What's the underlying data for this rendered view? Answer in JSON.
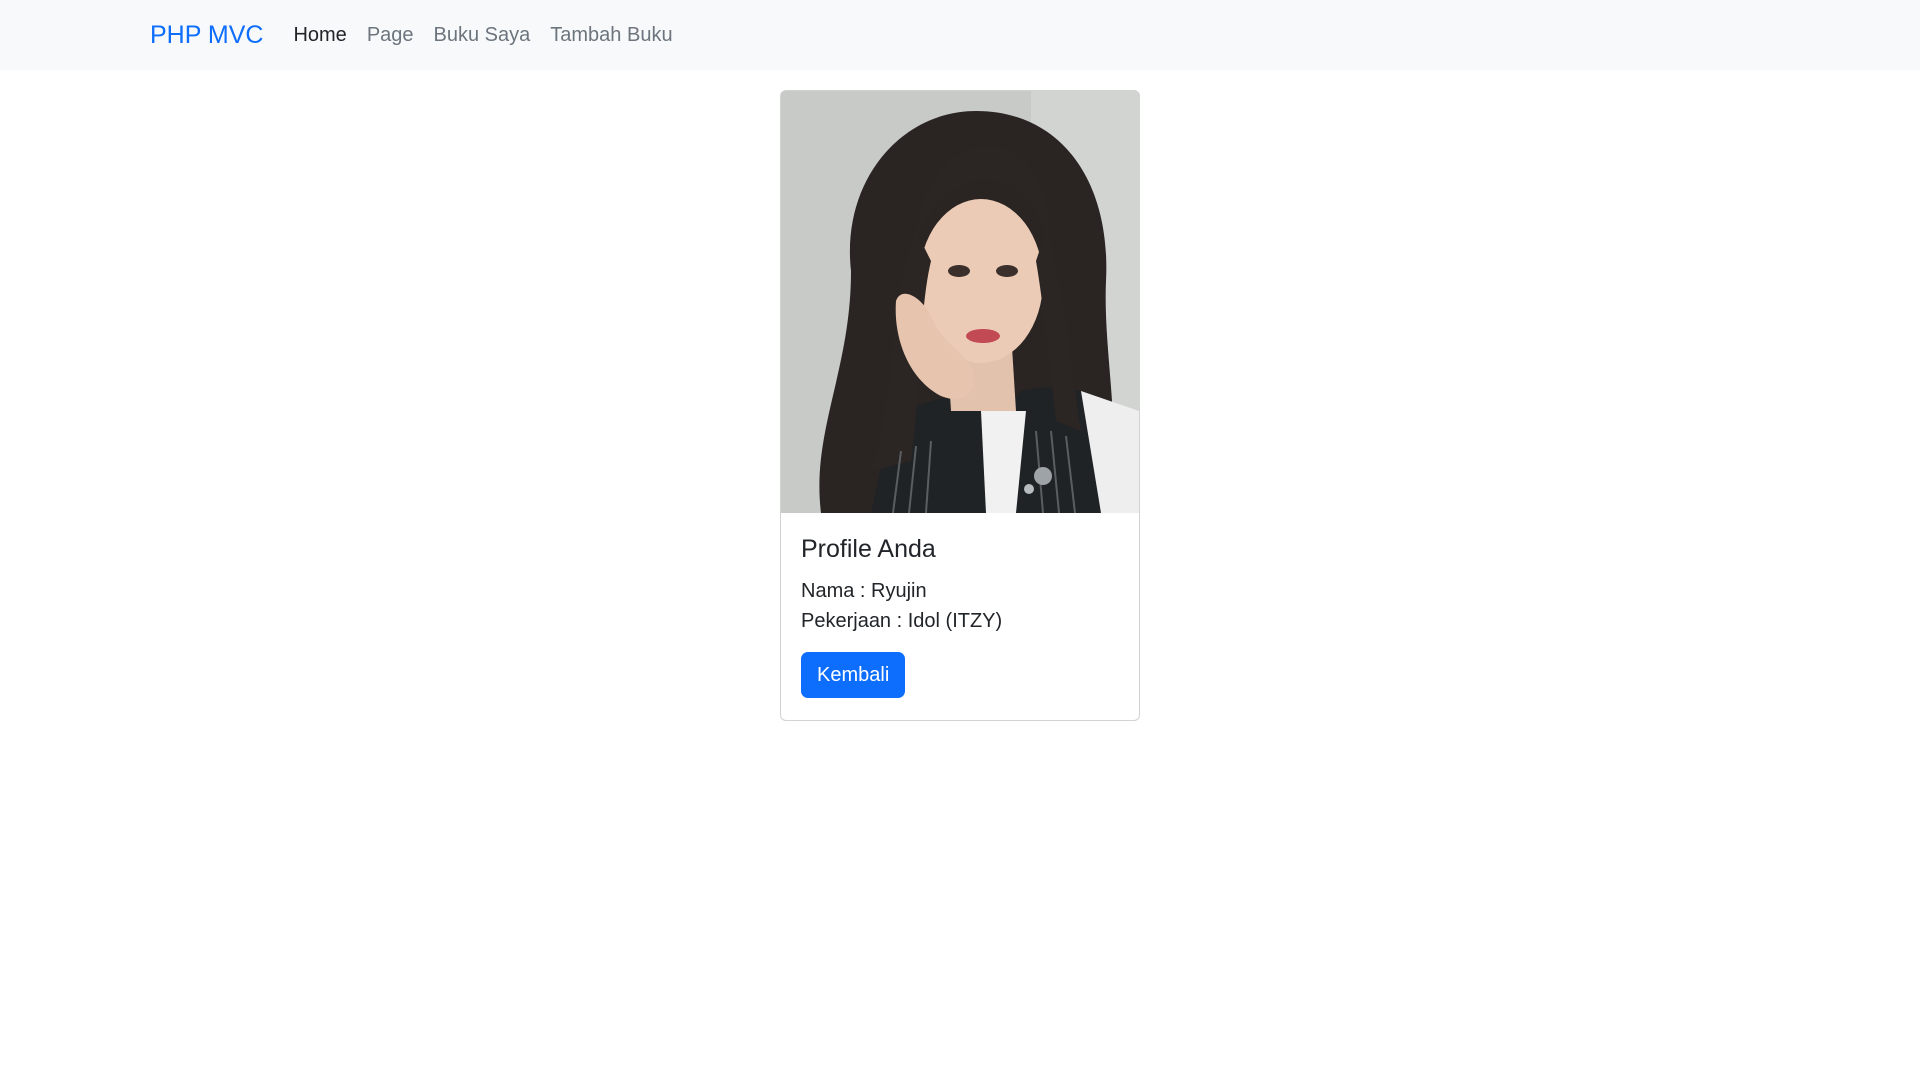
{
  "navbar": {
    "brand": "PHP MVC",
    "links": [
      {
        "label": "Home",
        "active": true
      },
      {
        "label": "Page",
        "active": false
      },
      {
        "label": "Buku Saya",
        "active": false
      },
      {
        "label": "Tambah Buku",
        "active": false
      }
    ]
  },
  "profile": {
    "photo_alt": "Profile photo",
    "title": "Profile Anda",
    "name_line": "Nama : Ryujin",
    "job_line": "Pekerjaan : Idol (ITZY)",
    "back_button": "Kembali"
  },
  "colors": {
    "primary": "#0d6efd",
    "navbar_bg": "#f8f9fa"
  }
}
